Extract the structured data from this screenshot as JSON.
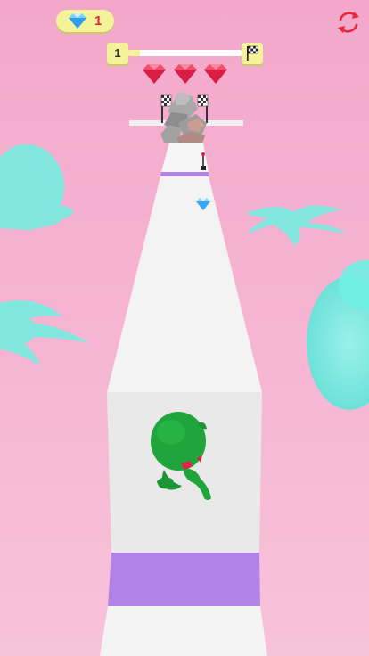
{
  "hud": {
    "gem_count": "1",
    "gem_icon": "diamond-icon",
    "restart_icon": "restart-icon",
    "level_number": "1",
    "finish_icon": "checkered-flag-icon",
    "progress": 0.1,
    "collected_gems": 3
  },
  "colors": {
    "hud_yellow": "#f4f39a",
    "gem_red": "#e0224a",
    "restart_red": "#e8283c",
    "path_white": "#f4f4f4",
    "path_purple": "#b283e6",
    "player_green": "#1fa13a",
    "foliage_cyan": "#6ff0e2",
    "sky_pink": "#f5b3d0"
  }
}
